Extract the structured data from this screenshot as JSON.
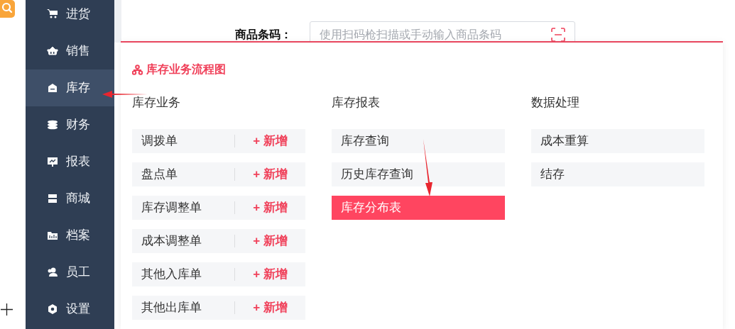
{
  "sidebar": {
    "items": [
      {
        "label": "进货",
        "selected": false
      },
      {
        "label": "销售",
        "selected": false
      },
      {
        "label": "库存",
        "selected": true
      },
      {
        "label": "财务",
        "selected": false
      },
      {
        "label": "报表",
        "selected": false
      },
      {
        "label": "商城",
        "selected": false
      },
      {
        "label": "档案",
        "selected": false
      },
      {
        "label": "员工",
        "selected": false
      },
      {
        "label": "设置",
        "selected": false
      }
    ]
  },
  "barcode": {
    "label": "商品条码：",
    "placeholder": "使用扫码枪扫描或手动输入商品条码"
  },
  "popup": {
    "title": "库存业务流程图",
    "columns": [
      {
        "heading": "库存业务",
        "items": [
          {
            "label": "调拨单",
            "action": "+ 新增",
            "selected": false
          },
          {
            "label": "盘点单",
            "action": "+ 新增",
            "selected": false
          },
          {
            "label": "库存调整单",
            "action": "+ 新增",
            "selected": false
          },
          {
            "label": "成本调整单",
            "action": "+ 新增",
            "selected": false
          },
          {
            "label": "其他入库单",
            "action": "+ 新增",
            "selected": false
          },
          {
            "label": "其他出库单",
            "action": "+ 新增",
            "selected": false
          }
        ]
      },
      {
        "heading": "库存报表",
        "items": [
          {
            "label": "库存查询",
            "selected": false
          },
          {
            "label": "历史库存查询",
            "selected": false
          },
          {
            "label": "库存分布表",
            "selected": true
          }
        ]
      },
      {
        "heading": "数据处理",
        "items": [
          {
            "label": "成本重算",
            "selected": false
          },
          {
            "label": "结存",
            "selected": false
          }
        ]
      }
    ]
  }
}
